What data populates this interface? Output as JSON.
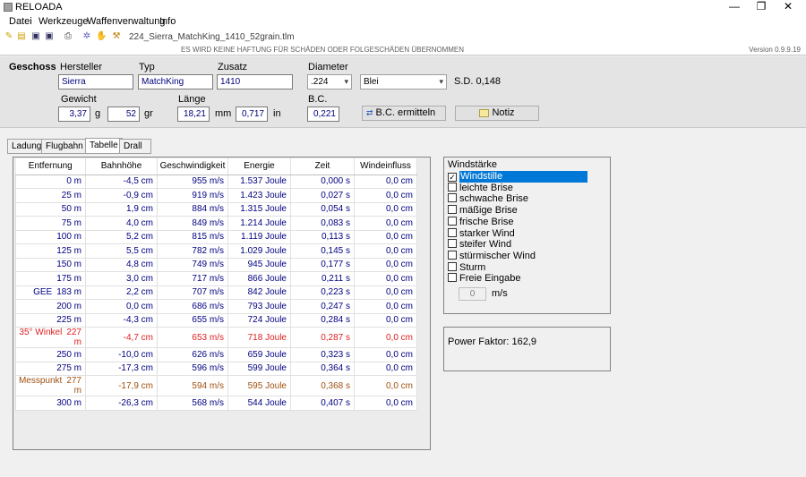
{
  "app": {
    "title": "RELOADA"
  },
  "window": {
    "minimize": "—",
    "maximize": "❐",
    "close": "✕"
  },
  "menu": [
    "Datei",
    "Werkzeuge",
    "Waffenverwaltung",
    "Info"
  ],
  "toolbar": {
    "filename": "224_Sierra_MatchKing_1410_52grain.tlm"
  },
  "disclaimer": "ES WIRD KEINE HAFTUNG FÜR SCHÄDEN ODER FOLGESCHÄDEN ÜBERNOMMEN",
  "version": "Version 0.9.9.19",
  "geschoss": {
    "label": "Geschoss",
    "hersteller_label": "Hersteller",
    "hersteller": "Sierra",
    "typ_label": "Typ",
    "typ": "MatchKing",
    "zusatz_label": "Zusatz",
    "zusatz": "1410",
    "diameter_label": "Diameter",
    "diameter": ".224",
    "material": "Blei",
    "sd_label": "S.D. 0,148",
    "gewicht_label": "Gewicht",
    "gewicht_g": "3,37",
    "g_unit": "g",
    "gewicht_gr": "52",
    "gr_unit": "gr",
    "laenge_label": "Länge",
    "laenge_mm": "18,21",
    "mm_unit": "mm",
    "laenge_in": "0,717",
    "in_unit": "in",
    "bc_label": "B.C.",
    "bc": "0,221",
    "bc_button": "B.C. ermitteln",
    "notiz_button": "Notiz"
  },
  "tabs": [
    "Ladung",
    "Flugbahn",
    "Tabelle",
    "Drall"
  ],
  "table": {
    "headers": [
      "Entfernung",
      "Bahnhöhe",
      "Geschwindigkeit",
      "Energie",
      "Zeit",
      "Windeinfluss"
    ],
    "rows": [
      {
        "label": "",
        "dist": "0 m",
        "hoehe": "-4,5 cm",
        "v": "955 m/s",
        "e": "1.537 Joule",
        "t": "0,000 s",
        "w": "0,0 cm",
        "style": ""
      },
      {
        "label": "",
        "dist": "25 m",
        "hoehe": "-0,9 cm",
        "v": "919 m/s",
        "e": "1.423 Joule",
        "t": "0,027 s",
        "w": "0,0 cm",
        "style": ""
      },
      {
        "label": "",
        "dist": "50 m",
        "hoehe": "1,9 cm",
        "v": "884 m/s",
        "e": "1.315 Joule",
        "t": "0,054 s",
        "w": "0,0 cm",
        "style": ""
      },
      {
        "label": "",
        "dist": "75 m",
        "hoehe": "4,0 cm",
        "v": "849 m/s",
        "e": "1.214 Joule",
        "t": "0,083 s",
        "w": "0,0 cm",
        "style": ""
      },
      {
        "label": "",
        "dist": "100 m",
        "hoehe": "5,2 cm",
        "v": "815 m/s",
        "e": "1.119 Joule",
        "t": "0,113 s",
        "w": "0,0 cm",
        "style": ""
      },
      {
        "label": "",
        "dist": "125 m",
        "hoehe": "5,5 cm",
        "v": "782 m/s",
        "e": "1.029 Joule",
        "t": "0,145 s",
        "w": "0,0 cm",
        "style": ""
      },
      {
        "label": "",
        "dist": "150 m",
        "hoehe": "4,8 cm",
        "v": "749 m/s",
        "e": "945 Joule",
        "t": "0,177 s",
        "w": "0,0 cm",
        "style": ""
      },
      {
        "label": "",
        "dist": "175 m",
        "hoehe": "3,0 cm",
        "v": "717 m/s",
        "e": "866 Joule",
        "t": "0,211 s",
        "w": "0,0 cm",
        "style": ""
      },
      {
        "label": "GEE",
        "dist": "183 m",
        "hoehe": "2,2 cm",
        "v": "707 m/s",
        "e": "842 Joule",
        "t": "0,223 s",
        "w": "0,0 cm",
        "style": ""
      },
      {
        "label": "",
        "dist": "200 m",
        "hoehe": "0,0 cm",
        "v": "686 m/s",
        "e": "793 Joule",
        "t": "0,247 s",
        "w": "0,0 cm",
        "style": ""
      },
      {
        "label": "",
        "dist": "225 m",
        "hoehe": "-4,3 cm",
        "v": "655 m/s",
        "e": "724 Joule",
        "t": "0,284 s",
        "w": "0,0 cm",
        "style": ""
      },
      {
        "label": "35° Winkel",
        "dist": "227 m",
        "hoehe": "-4,7 cm",
        "v": "653 m/s",
        "e": "718 Joule",
        "t": "0,287 s",
        "w": "0,0 cm",
        "style": "red"
      },
      {
        "label": "",
        "dist": "250 m",
        "hoehe": "-10,0 cm",
        "v": "626 m/s",
        "e": "659 Joule",
        "t": "0,323 s",
        "w": "0,0 cm",
        "style": ""
      },
      {
        "label": "",
        "dist": "275 m",
        "hoehe": "-17,3 cm",
        "v": "596 m/s",
        "e": "599 Joule",
        "t": "0,364 s",
        "w": "0,0 cm",
        "style": ""
      },
      {
        "label": "Messpunkt",
        "dist": "277 m",
        "hoehe": "-17,9 cm",
        "v": "594 m/s",
        "e": "595 Joule",
        "t": "0,368 s",
        "w": "0,0 cm",
        "style": "brown"
      },
      {
        "label": "",
        "dist": "300 m",
        "hoehe": "-26,3 cm",
        "v": "568 m/s",
        "e": "544 Joule",
        "t": "0,407 s",
        "w": "0,0 cm",
        "style": ""
      }
    ]
  },
  "wind": {
    "title": "Windstärke",
    "options": [
      "Windstille",
      "leichte Brise",
      "schwache Brise",
      "mäßige Brise",
      "frische Brise",
      "starker Wind",
      "steifer Wind",
      "stürmischer Wind",
      "Sturm",
      "Freie Eingabe"
    ],
    "selected": 0,
    "value": "0",
    "unit": "m/s"
  },
  "power_factor": "Power Faktor: 162,9",
  "colors": {
    "selection": "#0078d7",
    "value_text": "#000080",
    "red_row": "#e02020",
    "brown_row": "#a05010"
  }
}
